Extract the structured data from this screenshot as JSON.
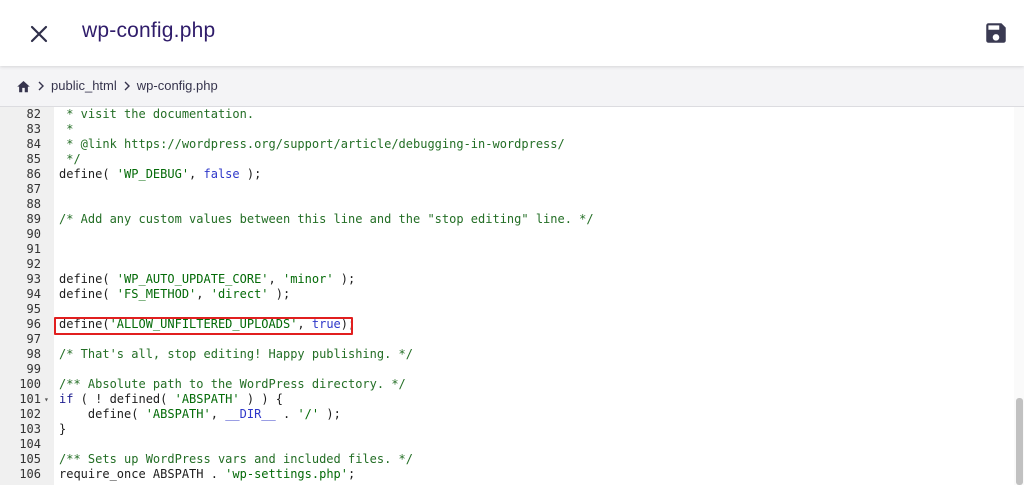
{
  "header": {
    "title": "wp-config.php",
    "close_icon": "close-icon",
    "save_icon": "save-icon"
  },
  "breadcrumb": {
    "home_icon": "home-icon",
    "items": [
      "public_html",
      "wp-config.php"
    ]
  },
  "editor": {
    "lines": [
      {
        "num": "82",
        "tokens": [
          {
            "t": " * visit the documentation.",
            "c": "comment"
          }
        ]
      },
      {
        "num": "83",
        "tokens": [
          {
            "t": " *",
            "c": "comment"
          }
        ]
      },
      {
        "num": "84",
        "tokens": [
          {
            "t": " * @link https://wordpress.org/support/article/debugging-in-wordpress/",
            "c": "comment"
          }
        ]
      },
      {
        "num": "85",
        "tokens": [
          {
            "t": " */",
            "c": "comment"
          }
        ]
      },
      {
        "num": "86",
        "tokens": [
          {
            "t": "define( ",
            "c": "plain"
          },
          {
            "t": "'WP_DEBUG'",
            "c": "string"
          },
          {
            "t": ", ",
            "c": "plain"
          },
          {
            "t": "false",
            "c": "const"
          },
          {
            "t": " );",
            "c": "plain"
          }
        ]
      },
      {
        "num": "87",
        "tokens": []
      },
      {
        "num": "88",
        "tokens": []
      },
      {
        "num": "89",
        "tokens": [
          {
            "t": "/* Add any custom values between this line and the \"stop editing\" line. */",
            "c": "comment"
          }
        ]
      },
      {
        "num": "90",
        "tokens": []
      },
      {
        "num": "91",
        "tokens": []
      },
      {
        "num": "92",
        "tokens": []
      },
      {
        "num": "93",
        "tokens": [
          {
            "t": "define( ",
            "c": "plain"
          },
          {
            "t": "'WP_AUTO_UPDATE_CORE'",
            "c": "string"
          },
          {
            "t": ", ",
            "c": "plain"
          },
          {
            "t": "'minor'",
            "c": "string"
          },
          {
            "t": " );",
            "c": "plain"
          }
        ]
      },
      {
        "num": "94",
        "tokens": [
          {
            "t": "define( ",
            "c": "plain"
          },
          {
            "t": "'FS_METHOD'",
            "c": "string"
          },
          {
            "t": ", ",
            "c": "plain"
          },
          {
            "t": "'direct'",
            "c": "string"
          },
          {
            "t": " );",
            "c": "plain"
          }
        ]
      },
      {
        "num": "95",
        "tokens": []
      },
      {
        "num": "96",
        "tokens": [
          {
            "t": "define(",
            "c": "plain"
          },
          {
            "t": "'ALLOW_UNFILTERED_UPLOADS'",
            "c": "string"
          },
          {
            "t": ", ",
            "c": "plain"
          },
          {
            "t": "true",
            "c": "const"
          },
          {
            "t": ");",
            "c": "plain"
          }
        ]
      },
      {
        "num": "97",
        "tokens": []
      },
      {
        "num": "98",
        "tokens": [
          {
            "t": "/* That's all, stop editing! Happy publishing. */",
            "c": "comment"
          }
        ]
      },
      {
        "num": "99",
        "tokens": []
      },
      {
        "num": "100",
        "tokens": [
          {
            "t": "/** Absolute path to the WordPress directory. */",
            "c": "comment"
          }
        ]
      },
      {
        "num": "101",
        "fold": true,
        "tokens": [
          {
            "t": "if",
            "c": "kw"
          },
          {
            "t": " ( ! defined( ",
            "c": "plain"
          },
          {
            "t": "'ABSPATH'",
            "c": "string"
          },
          {
            "t": " ) ) {",
            "c": "plain"
          }
        ]
      },
      {
        "num": "102",
        "tokens": [
          {
            "t": "    define( ",
            "c": "plain"
          },
          {
            "t": "'ABSPATH'",
            "c": "string"
          },
          {
            "t": ", ",
            "c": "plain"
          },
          {
            "t": "__DIR__",
            "c": "const"
          },
          {
            "t": " . ",
            "c": "plain"
          },
          {
            "t": "'/'",
            "c": "string"
          },
          {
            "t": " );",
            "c": "plain"
          }
        ]
      },
      {
        "num": "103",
        "tokens": [
          {
            "t": "}",
            "c": "plain"
          }
        ]
      },
      {
        "num": "104",
        "tokens": []
      },
      {
        "num": "105",
        "tokens": [
          {
            "t": "/** Sets up WordPress vars and included files. */",
            "c": "comment"
          }
        ]
      },
      {
        "num": "106",
        "tokens": [
          {
            "t": "require_once ABSPATH . ",
            "c": "plain"
          },
          {
            "t": "'wp-settings.php'",
            "c": "string"
          },
          {
            "t": ";",
            "c": "plain"
          }
        ]
      }
    ],
    "highlighted_line": "96"
  },
  "colors": {
    "highlight_border": "#e11f1f",
    "title": "#2f1c6a",
    "comment": "#236e25",
    "string": "#036a07"
  }
}
